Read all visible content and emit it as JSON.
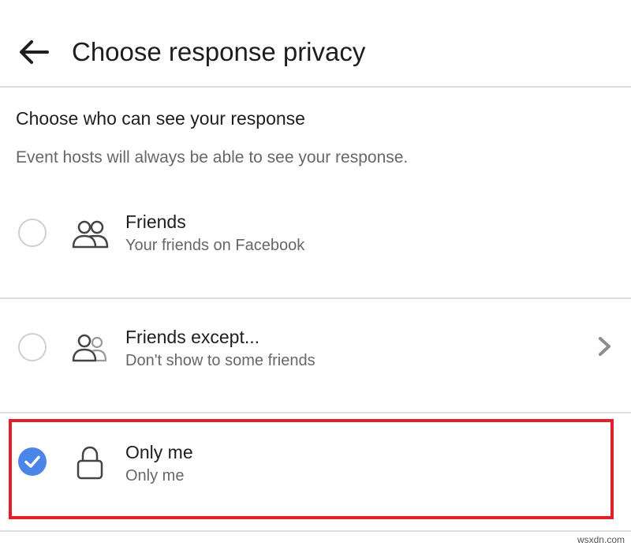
{
  "header": {
    "title": "Choose response privacy"
  },
  "section": {
    "heading": "Choose who can see your response",
    "subtext": "Event hosts will always be able to see your response."
  },
  "options": [
    {
      "title": "Friends",
      "subtitle": "Your friends on Facebook",
      "icon": "friends-icon",
      "selected": false
    },
    {
      "title": "Friends except...",
      "subtitle": "Don't show to some friends",
      "icon": "friends-except-icon",
      "selected": false
    },
    {
      "title": "Only me",
      "subtitle": "Only me",
      "icon": "lock-icon",
      "selected": true
    }
  ],
  "colors": {
    "accent": "#4a86e8",
    "highlight": "#e0202a",
    "divider": "#dadde1",
    "secondary_text": "#65676b"
  },
  "watermark": "wsxdn.com"
}
